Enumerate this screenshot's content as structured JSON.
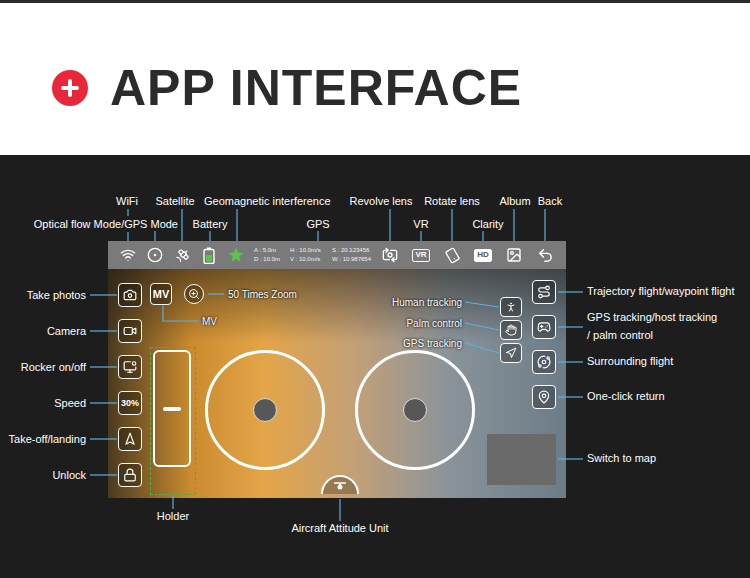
{
  "header": {
    "title": "APP INTERFACE"
  },
  "status_bar": {
    "telemetry": [
      "A : 5.0m",
      "H : 10.0m/s",
      "S : 20.123456",
      "D : 10.0m",
      "V : 10.0m/s",
      "W : 10.987654"
    ],
    "vr_badge": "VR",
    "hd_badge": "HD"
  },
  "controls": {
    "mv_button": "MV",
    "speed": "30%"
  },
  "callouts": {
    "top": [
      {
        "label": "WiFi"
      },
      {
        "label": "Satellite"
      },
      {
        "label": "Geomagnetic interference"
      },
      {
        "label": "Revolve lens"
      },
      {
        "label": "Rotate lens"
      },
      {
        "label": "Album"
      },
      {
        "label": "Back"
      },
      {
        "label": "Optical flow Mode/GPS Mode"
      },
      {
        "label": "Battery"
      },
      {
        "label": "GPS"
      },
      {
        "label": "VR"
      },
      {
        "label": "Clarity"
      }
    ],
    "left": [
      {
        "label": "Take photos"
      },
      {
        "label": "Camera"
      },
      {
        "label": "Rocker on/off"
      },
      {
        "label": "Speed"
      },
      {
        "label": "Take-off/landing"
      },
      {
        "label": "Unlock"
      }
    ],
    "right": [
      {
        "lines": [
          "Trajectory flight/waypoint flight"
        ]
      },
      {
        "lines": [
          "GPS tracking/host tracking",
          "/ palm control"
        ]
      },
      {
        "lines": [
          "Surrounding flight"
        ]
      },
      {
        "lines": [
          "One-click return"
        ]
      },
      {
        "lines": [
          "Switch to map"
        ]
      }
    ],
    "bottom": [
      {
        "label": "Holder"
      },
      {
        "label": "Aircraft Attitude Unit"
      }
    ],
    "inside": [
      {
        "label": "MV"
      },
      {
        "label": "50 Times Zoom"
      },
      {
        "label": "Human tracking"
      },
      {
        "label": "Palm control"
      },
      {
        "label": "GPS tracking"
      }
    ]
  }
}
